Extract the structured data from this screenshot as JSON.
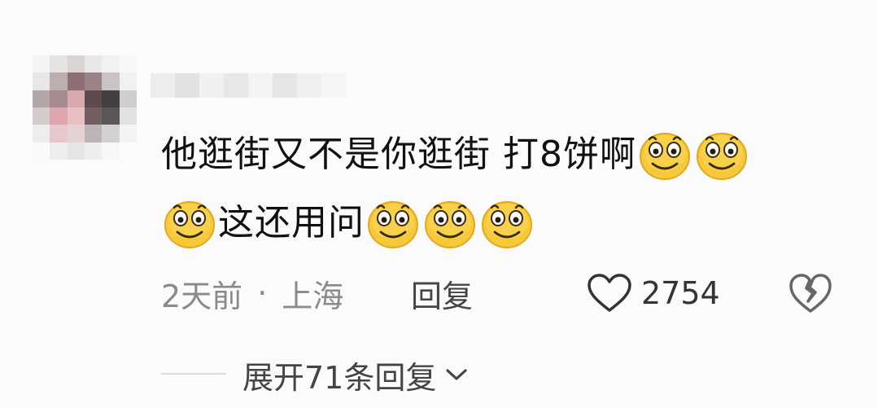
{
  "comment": {
    "line1_text": "他逛街又不是你逛街 打8饼啊",
    "line2_text": "这还用问",
    "emoji_icon": "grinning-face-icon"
  },
  "meta": {
    "time": "2天前",
    "separator": "·",
    "location": "上海",
    "reply_label": "回复"
  },
  "likes": {
    "count": "2754",
    "icon": "heart-outline-icon"
  },
  "dislike": {
    "icon": "broken-heart-icon"
  },
  "replies": {
    "expand_label": "展开71条回复",
    "icon": "chevron-down-icon"
  },
  "colors": {
    "emoji_yellow": "#f6c83a",
    "emoji_outline": "#e0a51c",
    "meta_gray": "#8a8a8a",
    "text_dark": "#111111"
  }
}
